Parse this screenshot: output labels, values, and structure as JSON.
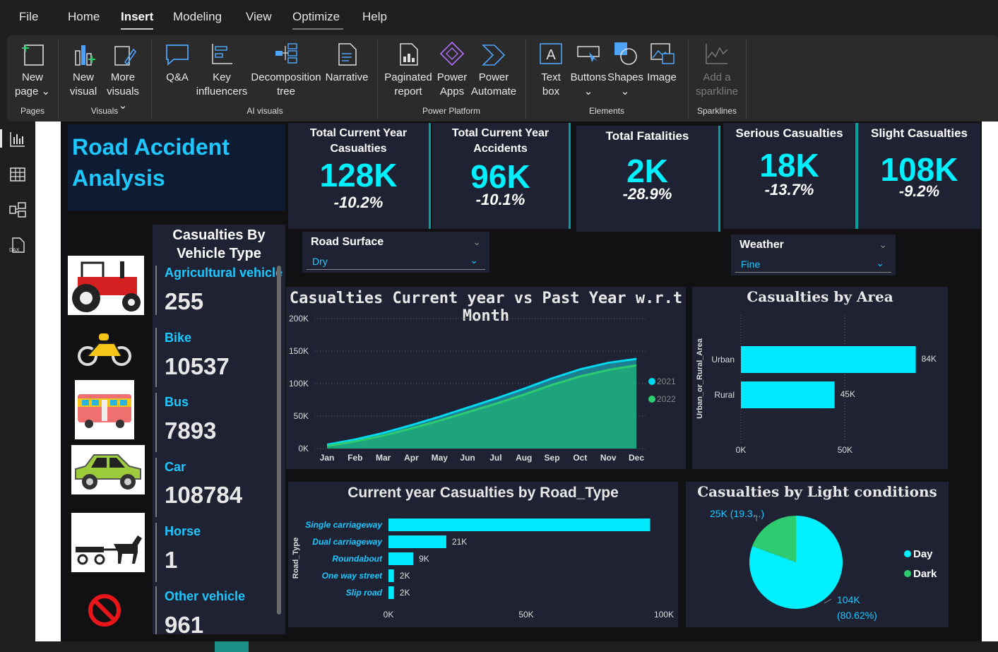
{
  "menu": {
    "items": [
      "File",
      "Home",
      "Insert",
      "Modeling",
      "View",
      "Optimize",
      "Help"
    ],
    "active": "Insert"
  },
  "ribbon": {
    "new_page": [
      "New",
      "page ⌄"
    ],
    "new_visual": [
      "New",
      "visual"
    ],
    "more_visuals": [
      "More",
      "visuals ⌄"
    ],
    "qna": "Q&A",
    "key_influencers": [
      "Key",
      "influencers"
    ],
    "decomposition_tree": [
      "Decomposition",
      "tree"
    ],
    "narrative": "Narrative",
    "paginated_report": [
      "Paginated",
      "report"
    ],
    "power_apps": [
      "Power",
      "Apps"
    ],
    "power_automate": [
      "Power",
      "Automate"
    ],
    "text_box": [
      "Text",
      "box"
    ],
    "buttons": [
      "Buttons",
      "⌄"
    ],
    "shapes": [
      "Shapes",
      "⌄"
    ],
    "image": "Image",
    "add_sparkline": [
      "Add a",
      "sparkline"
    ],
    "groups": {
      "pages": "Pages",
      "visuals": "Visuals",
      "ai_visuals": "AI visuals",
      "power_platform": "Power Platform",
      "elements": "Elements",
      "sparklines": "Sparklines"
    }
  },
  "report": {
    "title": [
      "Road Accident",
      "Analysis"
    ],
    "kpis": [
      {
        "label": [
          "Total Current Year",
          "Casualties"
        ],
        "value": "128K",
        "change": "-10.2%"
      },
      {
        "label": [
          "Total Current Year",
          "Accidents"
        ],
        "value": "96K",
        "change": "-10.1%"
      },
      {
        "label": [
          "Total Fatalities"
        ],
        "value": "2K",
        "change": "-28.9%"
      },
      {
        "label": [
          "Serious Casualties"
        ],
        "value": "18K",
        "change": "-13.7%"
      },
      {
        "label": [
          "Slight Casualties"
        ],
        "value": "108K",
        "change": "-9.2%"
      }
    ],
    "vehicle": {
      "title": [
        "Casualties By",
        "Vehicle Type"
      ],
      "items": [
        {
          "name": "Agricultural vehicle",
          "value": "255"
        },
        {
          "name": "Bike",
          "value": "10537"
        },
        {
          "name": "Bus",
          "value": "7893"
        },
        {
          "name": "Car",
          "value": "108784"
        },
        {
          "name": "Horse",
          "value": "1"
        },
        {
          "name": "Other vehicle",
          "value": "961"
        }
      ]
    },
    "slicers": {
      "road_surface": {
        "title": "Road Surface",
        "value": "Dry"
      },
      "weather": {
        "title": "Weather",
        "value": "Fine"
      }
    },
    "colors": {
      "accent": "#00f0ff",
      "accent_dark": "#1ec8ff",
      "panel": "#1f2233",
      "green": "#2ecc71"
    }
  },
  "chart_data": [
    {
      "type": "area",
      "title": "Casualties Current year vs Past Year w.r.t Month",
      "categories": [
        "Jan",
        "Feb",
        "Mar",
        "Apr",
        "May",
        "Jun",
        "Jul",
        "Aug",
        "Sep",
        "Oct",
        "Nov",
        "Dec"
      ],
      "y_ticks": [
        "0K",
        "50K",
        "100K",
        "150K",
        "200K"
      ],
      "ylim": [
        0,
        200000
      ],
      "series": [
        {
          "name": "2021",
          "color": "#00d8f0",
          "values": [
            6000,
            14000,
            24000,
            36000,
            49000,
            63000,
            77000,
            92000,
            108000,
            122000,
            132000,
            138000
          ]
        },
        {
          "name": "2022",
          "color": "#2ecc71",
          "values": [
            4000,
            11000,
            20000,
            31000,
            43000,
            56000,
            69000,
            83000,
            98000,
            111000,
            121000,
            128000
          ]
        }
      ],
      "legend": "right"
    },
    {
      "type": "bar",
      "orientation": "horizontal",
      "title": "Casualties by Area",
      "ylabel": "Urban_or_Rural_Area",
      "categories": [
        "Urban",
        "Rural"
      ],
      "values": [
        84000,
        45000
      ],
      "data_labels": [
        "84K",
        "45K"
      ],
      "x_ticks": [
        "0K",
        "50K"
      ],
      "xlim": [
        0,
        95000
      ]
    },
    {
      "type": "bar",
      "orientation": "horizontal",
      "title": "Current year Casualties by Road_Type",
      "ylabel": "Road_Type",
      "categories": [
        "Single carriageway",
        "Dual carriageway",
        "Roundabout",
        "One way street",
        "Slip road"
      ],
      "values": [
        95000,
        21000,
        9000,
        2000,
        2000
      ],
      "data_labels": [
        "",
        "21K",
        "9K",
        "2K",
        "2K"
      ],
      "x_ticks": [
        "0K",
        "50K",
        "100K"
      ],
      "xlim": [
        0,
        100000
      ]
    },
    {
      "type": "pie",
      "title": "Casualties by Light conditions",
      "categories": [
        "Day",
        "Dark"
      ],
      "values": [
        104000,
        25000
      ],
      "data_labels": [
        "104K",
        "(80.62%)",
        "25K (19.3...)"
      ],
      "colors": [
        "#00f0ff",
        "#2ecc71"
      ],
      "legend": "right"
    }
  ]
}
